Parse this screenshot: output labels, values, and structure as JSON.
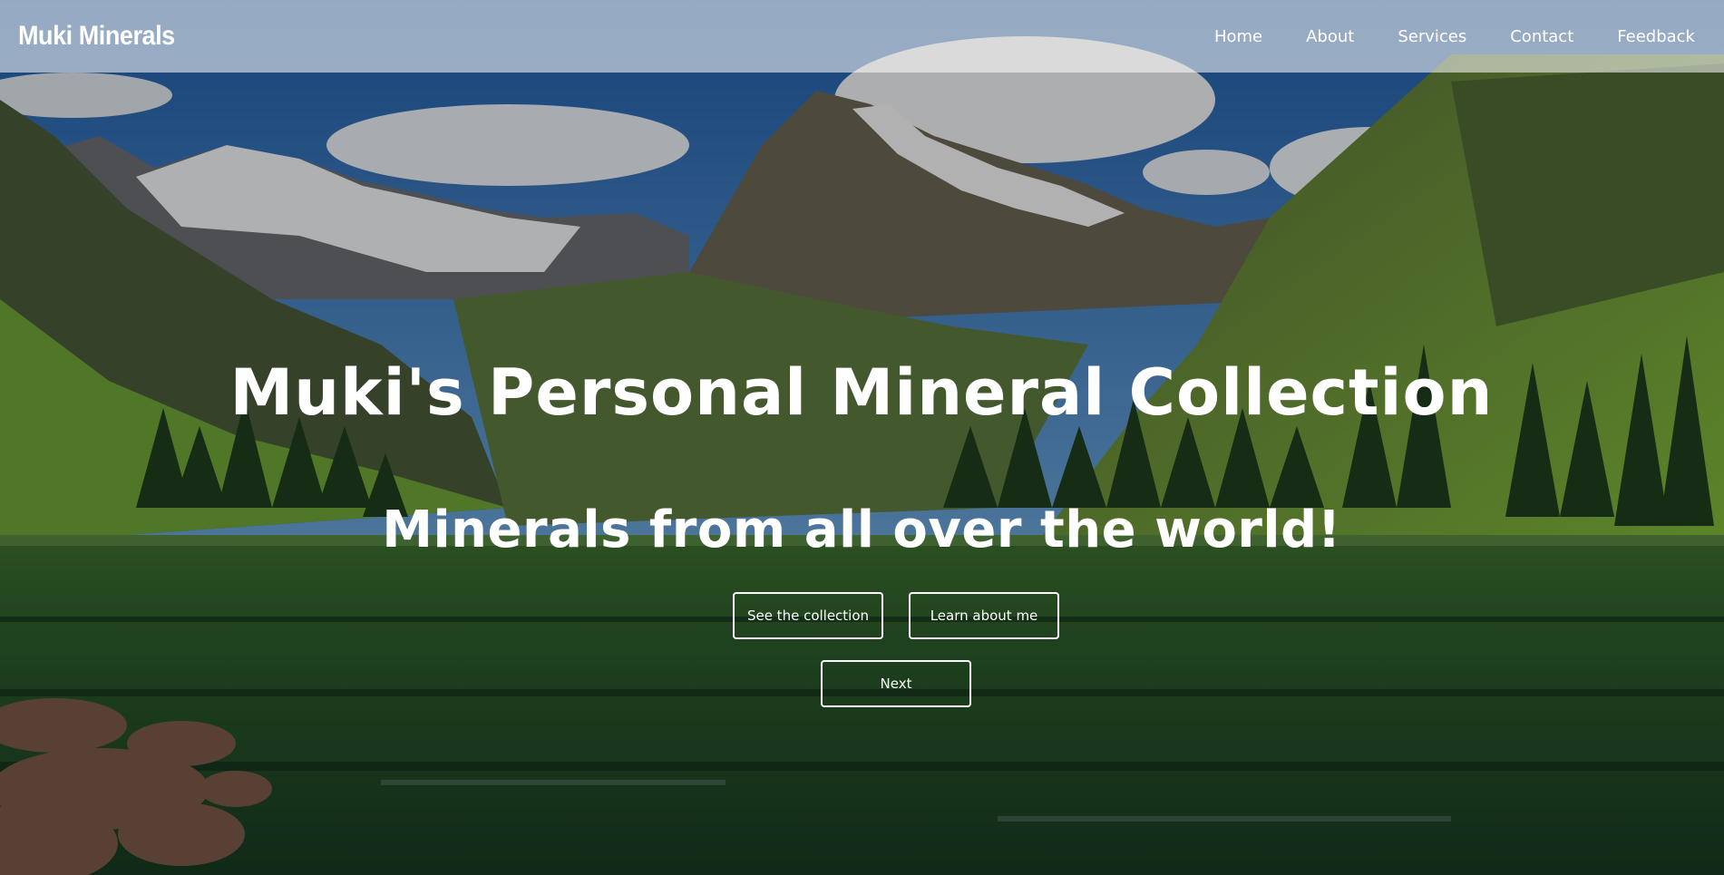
{
  "brand": {
    "name": "Muki Minerals"
  },
  "nav": {
    "items": [
      {
        "label": "Home"
      },
      {
        "label": "About"
      },
      {
        "label": "Services"
      },
      {
        "label": "Contact"
      },
      {
        "label": "Feedback"
      }
    ]
  },
  "hero": {
    "title": "Muki's Personal Mineral Collection",
    "subtitle": "Minerals from all over the world!",
    "buttons": {
      "collection": "See the collection",
      "learn": "Learn about me",
      "next": "Next"
    },
    "background": "mountain-lake-landscape"
  },
  "colors": {
    "nav_overlay": "#ffffffcc",
    "text": "#ffffff",
    "sky": "#2f6fb5",
    "grass": "#5fa02e",
    "water": "#1f4a2a"
  }
}
